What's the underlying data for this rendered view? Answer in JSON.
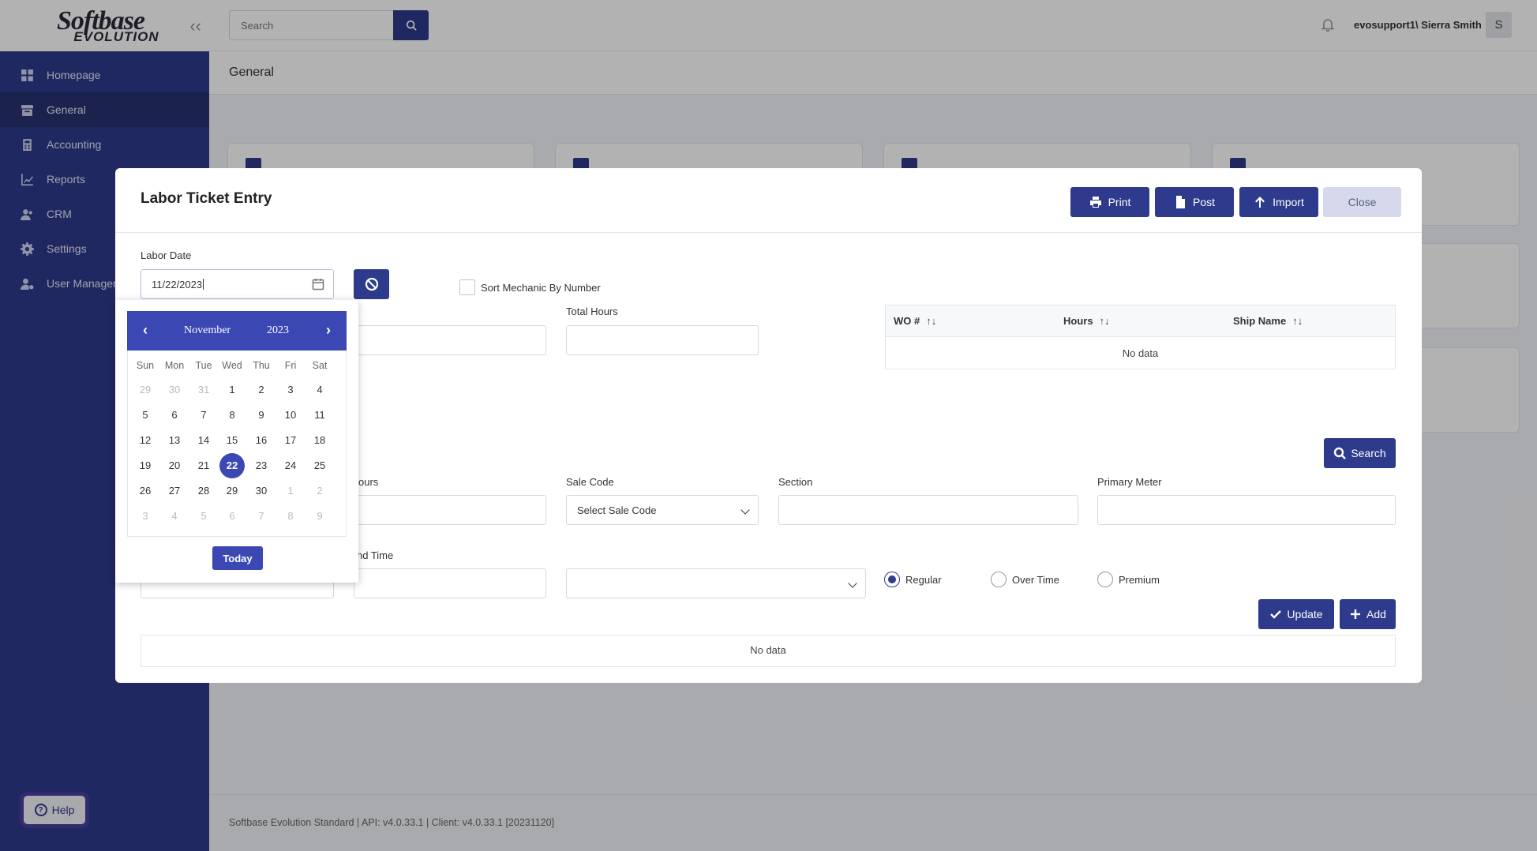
{
  "sidebar": {
    "logo_line1": "Softbase",
    "logo_line2": "EVOLUTION",
    "items": [
      {
        "label": "Homepage",
        "icon": "dashboard-icon"
      },
      {
        "label": "General",
        "icon": "archive-icon",
        "active": true
      },
      {
        "label": "Accounting",
        "icon": "calculator-icon"
      },
      {
        "label": "Reports",
        "icon": "chart-icon"
      },
      {
        "label": "CRM",
        "icon": "users-icon"
      },
      {
        "label": "Settings",
        "icon": "gear-icon"
      },
      {
        "label": "User Managem",
        "icon": "user-cog-icon"
      }
    ],
    "help_label": "Help"
  },
  "header": {
    "search_placeholder": "Search",
    "user": "evosupport1\\ Sierra Smith",
    "avatar_letter": "S"
  },
  "breadcrumb": "General",
  "footer": "Softbase Evolution Standard | API: v4.0.33.1 | Client: v4.0.33.1 [20231120]",
  "modal": {
    "title": "Labor Ticket Entry",
    "buttons": {
      "print": "Print",
      "post": "Post",
      "import": "Import",
      "close": "Close"
    },
    "labor_date_label": "Labor Date",
    "labor_date_value": "11/22/2023",
    "sort_mechanic_label": "Sort Mechanic By Number",
    "total_hours_label": "Total Hours",
    "wo_grid": {
      "columns": [
        "WO #",
        "Hours",
        "Ship Name"
      ],
      "empty": "No data"
    },
    "search_label": "Search",
    "hours_label": "ours",
    "sale_code_label": "Sale Code",
    "sale_code_placeholder": "Select Sale Code",
    "section_label": "Section",
    "primary_meter_label": "Primary Meter",
    "end_time_label": "nd Time",
    "radios": [
      {
        "label": "Regular",
        "checked": true
      },
      {
        "label": "Over Time",
        "checked": false
      },
      {
        "label": "Premium",
        "checked": false
      }
    ],
    "update_label": "Update",
    "add_label": "Add",
    "bottom_empty": "No data"
  },
  "datepicker": {
    "month": "November",
    "year": "2023",
    "prev": "‹",
    "next": "›",
    "weekdays": [
      "Sun",
      "Mon",
      "Tue",
      "Wed",
      "Thu",
      "Fri",
      "Sat"
    ],
    "weeks": [
      [
        "29",
        "30",
        "31",
        "1",
        "2",
        "3",
        "4"
      ],
      [
        "5",
        "6",
        "7",
        "8",
        "9",
        "10",
        "11"
      ],
      [
        "12",
        "13",
        "14",
        "15",
        "16",
        "17",
        "18"
      ],
      [
        "19",
        "20",
        "21",
        "22",
        "23",
        "24",
        "25"
      ],
      [
        "26",
        "27",
        "28",
        "29",
        "30",
        "1",
        "2"
      ],
      [
        "3",
        "4",
        "5",
        "6",
        "7",
        "8",
        "9"
      ]
    ],
    "selected": "22",
    "today_label": "Today"
  },
  "colors": {
    "primary": "#2e3a8c",
    "picker": "#3b48b4",
    "close_btn": "#d6d9ec"
  }
}
